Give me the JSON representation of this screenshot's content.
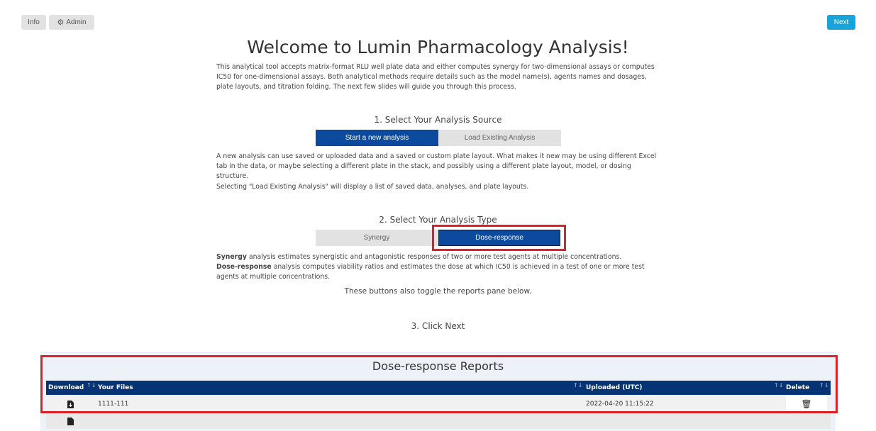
{
  "header": {
    "info_label": "Info",
    "admin_label": "Admin",
    "next_label": "Next",
    "admin_icon": "gears-icon"
  },
  "title": "Welcome to Lumin Pharmacology Analysis!",
  "intro": "This analytical tool accepts matrix-format RLU well plate data and either computes synergy for two-dimensional assays or computes IC50 for one-dimensional assays. Both analytical methods require details such as the model name(s), agents names and dosages, plate layouts, and titration folding. The next few slides will guide you through this process.",
  "step1": {
    "heading": "1. Select Your Analysis Source",
    "new_label": "Start a new analysis",
    "load_label": "Load Existing Analysis",
    "new_desc": "A new analysis can use saved or uploaded data and a saved or custom plate layout. What makes it new may be using different Excel tab in the data, or maybe selecting a different plate in the stack, and possibly using a different plate layout, model, or dosing structure.",
    "load_desc": "Selecting \"Load Existing Analysis\" will display a list of saved data, analyses, and plate layouts."
  },
  "step2": {
    "heading": "2. Select Your Analysis Type",
    "synergy_label": "Synergy",
    "dose_label": "Dose-response",
    "synergy_term": "Synergy",
    "synergy_desc": " analysis estimates synergistic and antagonistic responses of two or more test agents at multiple concentrations.",
    "dose_term": "Dose-response",
    "dose_desc": " analysis computes viability ratios and estimates the dose at which IC50 is achieved in a test of one or more test agents at multiple concentrations.",
    "toggle_note": "These buttons also toggle the reports pane below."
  },
  "step3": {
    "heading": "3. Click Next"
  },
  "reports": {
    "title": "Dose-response Reports",
    "columns": [
      "Download",
      "Your Files",
      "Uploaded (UTC)",
      "Delete"
    ],
    "rows": [
      {
        "file": "1111-111",
        "uploaded": "2022-04-20 11:15:22"
      },
      {
        "file": "",
        "uploaded": ""
      }
    ]
  },
  "colors": {
    "active": "#0b4a9c",
    "next": "#1aa3d9",
    "table_header": "#063374",
    "highlight": "#e01f26"
  }
}
